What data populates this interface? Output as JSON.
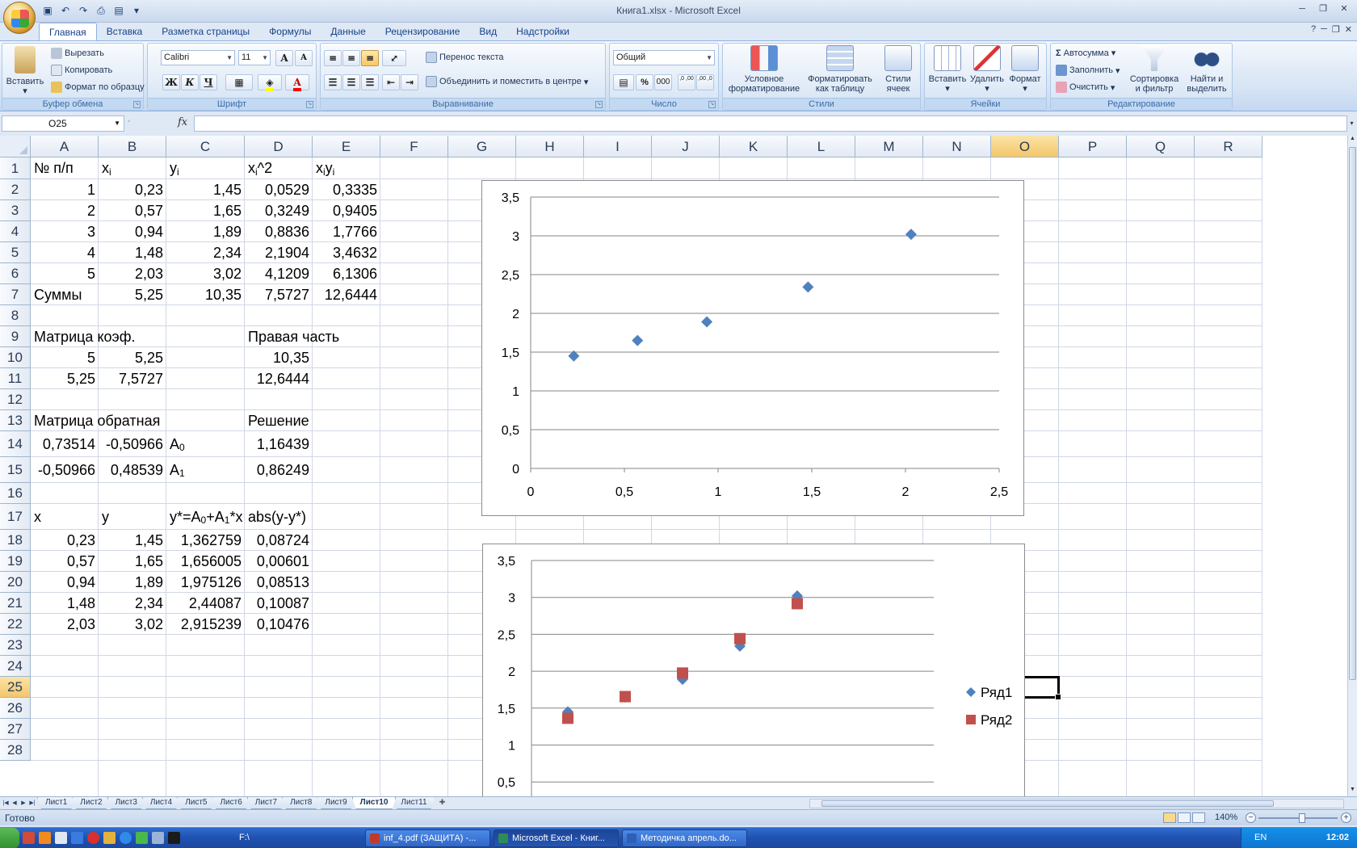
{
  "window": {
    "title": "Книга1.xlsx - Microsoft Excel"
  },
  "qat": {
    "items": [
      "save-icon",
      "undo-icon",
      "redo-icon",
      "print-preview-icon",
      "print-icon",
      "customize-icon"
    ]
  },
  "ribbon_tabs": [
    "Главная",
    "Вставка",
    "Разметка страницы",
    "Формулы",
    "Данные",
    "Рецензирование",
    "Вид",
    "Надстройки"
  ],
  "ribbon": {
    "clipboard": {
      "label": "Буфер обмена",
      "paste": "Вставить",
      "cut": "Вырезать",
      "copy": "Копировать",
      "format_painter": "Формат по образцу"
    },
    "font": {
      "label": "Шрифт",
      "name": "Calibri",
      "size": "11",
      "bold": "Ж",
      "italic": "К",
      "underline": "Ч",
      "grow": "A",
      "shrink": "A"
    },
    "alignment": {
      "label": "Выравнивание",
      "wrap": "Перенос текста",
      "merge": "Объединить и поместить в центре"
    },
    "number": {
      "label": "Число",
      "format": "Общий",
      "percent": "%",
      "thousands": "000",
      "inc_decimal": ",0 ,00",
      "dec_decimal": ",00 ,0"
    },
    "styles": {
      "label": "Стили",
      "conditional": "Условное форматирование",
      "as_table": "Форматировать как таблицу",
      "cell_styles": "Стили ячеек"
    },
    "cells": {
      "label": "Ячейки",
      "insert": "Вставить",
      "delete": "Удалить",
      "format": "Формат"
    },
    "editing": {
      "label": "Редактирование",
      "autosum": "Автосумма",
      "fill": "Заполнить",
      "clear": "Очистить",
      "sort": "Сортировка и фильтр",
      "find": "Найти и выделить"
    }
  },
  "formula_bar": {
    "name_box": "O25",
    "fx": "fx",
    "value": ""
  },
  "columns": [
    "A",
    "B",
    "C",
    "D",
    "E",
    "F",
    "G",
    "H",
    "I",
    "J",
    "K",
    "L",
    "M",
    "N",
    "O",
    "P",
    "Q",
    "R"
  ],
  "rows": [
    "1",
    "2",
    "3",
    "4",
    "5",
    "6",
    "7",
    "8",
    "9",
    "10",
    "11",
    "12",
    "13",
    "14",
    "15",
    "16",
    "17",
    "18",
    "19",
    "20",
    "21",
    "22",
    "23",
    "24",
    "25",
    "26",
    "27",
    "28"
  ],
  "cells": [
    {
      "ref": "A1",
      "text": "№ п/п"
    },
    {
      "ref": "B1",
      "text": "x",
      "sub": "i"
    },
    {
      "ref": "C1",
      "text": "y",
      "sub": "i"
    },
    {
      "ref": "D1",
      "text": "x",
      "sub": "i",
      "tail": "^2"
    },
    {
      "ref": "E1",
      "text": "x",
      "sub": "i",
      "tail": "y",
      "sub2": "i"
    },
    {
      "ref": "A2",
      "text": "1",
      "align": "r"
    },
    {
      "ref": "B2",
      "text": "0,23",
      "align": "r"
    },
    {
      "ref": "C2",
      "text": "1,45",
      "align": "r"
    },
    {
      "ref": "D2",
      "text": "0,0529",
      "align": "r"
    },
    {
      "ref": "E2",
      "text": "0,3335",
      "align": "r"
    },
    {
      "ref": "A3",
      "text": "2",
      "align": "r"
    },
    {
      "ref": "B3",
      "text": "0,57",
      "align": "r"
    },
    {
      "ref": "C3",
      "text": "1,65",
      "align": "r"
    },
    {
      "ref": "D3",
      "text": "0,3249",
      "align": "r"
    },
    {
      "ref": "E3",
      "text": "0,9405",
      "align": "r"
    },
    {
      "ref": "A4",
      "text": "3",
      "align": "r"
    },
    {
      "ref": "B4",
      "text": "0,94",
      "align": "r"
    },
    {
      "ref": "C4",
      "text": "1,89",
      "align": "r"
    },
    {
      "ref": "D4",
      "text": "0,8836",
      "align": "r"
    },
    {
      "ref": "E4",
      "text": "1,7766",
      "align": "r"
    },
    {
      "ref": "A5",
      "text": "4",
      "align": "r"
    },
    {
      "ref": "B5",
      "text": "1,48",
      "align": "r"
    },
    {
      "ref": "C5",
      "text": "2,34",
      "align": "r"
    },
    {
      "ref": "D5",
      "text": "2,1904",
      "align": "r"
    },
    {
      "ref": "E5",
      "text": "3,4632",
      "align": "r"
    },
    {
      "ref": "A6",
      "text": "5",
      "align": "r"
    },
    {
      "ref": "B6",
      "text": "2,03",
      "align": "r"
    },
    {
      "ref": "C6",
      "text": "3,02",
      "align": "r"
    },
    {
      "ref": "D6",
      "text": "4,1209",
      "align": "r"
    },
    {
      "ref": "E6",
      "text": "6,1306",
      "align": "r"
    },
    {
      "ref": "A7",
      "text": "Суммы"
    },
    {
      "ref": "B7",
      "text": "5,25",
      "align": "r"
    },
    {
      "ref": "C7",
      "text": "10,35",
      "align": "r"
    },
    {
      "ref": "D7",
      "text": "7,5727",
      "align": "r"
    },
    {
      "ref": "E7",
      "text": "12,6444",
      "align": "r"
    },
    {
      "ref": "A9",
      "text": "Матрица коэф."
    },
    {
      "ref": "D9",
      "text": "Правая часть"
    },
    {
      "ref": "A10",
      "text": "5",
      "align": "r"
    },
    {
      "ref": "B10",
      "text": "5,25",
      "align": "r"
    },
    {
      "ref": "D10",
      "text": "10,35",
      "align": "r"
    },
    {
      "ref": "A11",
      "text": "5,25",
      "align": "r"
    },
    {
      "ref": "B11",
      "text": "7,5727",
      "align": "r"
    },
    {
      "ref": "D11",
      "text": "12,6444",
      "align": "r"
    },
    {
      "ref": "A13",
      "text": "Матрица обратная"
    },
    {
      "ref": "D13",
      "text": "Решение"
    },
    {
      "ref": "A14",
      "text": "0,73514",
      "align": "r"
    },
    {
      "ref": "B14",
      "text": "-0,50966",
      "align": "r"
    },
    {
      "ref": "C14",
      "text": "A",
      "sub": "0"
    },
    {
      "ref": "D14",
      "text": "1,16439",
      "align": "r"
    },
    {
      "ref": "A15",
      "text": "-0,50966",
      "align": "r"
    },
    {
      "ref": "B15",
      "text": "0,48539",
      "align": "r"
    },
    {
      "ref": "C15",
      "text": "A",
      "sub": "1"
    },
    {
      "ref": "D15",
      "text": "0,86249",
      "align": "r"
    },
    {
      "ref": "A17",
      "text": "x"
    },
    {
      "ref": "B17",
      "text": "y"
    },
    {
      "ref": "C17",
      "text": "y*=A",
      "sub": "0",
      "tail": "+A",
      "sub2": "1",
      "tail2": "*x"
    },
    {
      "ref": "D17",
      "text": "abs(y-y*)"
    },
    {
      "ref": "A18",
      "text": "0,23",
      "align": "r"
    },
    {
      "ref": "B18",
      "text": "1,45",
      "align": "r"
    },
    {
      "ref": "C18",
      "text": "1,362759",
      "align": "r"
    },
    {
      "ref": "D18",
      "text": "0,08724",
      "align": "r"
    },
    {
      "ref": "A19",
      "text": "0,57",
      "align": "r"
    },
    {
      "ref": "B19",
      "text": "1,65",
      "align": "r"
    },
    {
      "ref": "C19",
      "text": "1,656005",
      "align": "r"
    },
    {
      "ref": "D19",
      "text": "0,00601",
      "align": "r"
    },
    {
      "ref": "A20",
      "text": "0,94",
      "align": "r"
    },
    {
      "ref": "B20",
      "text": "1,89",
      "align": "r"
    },
    {
      "ref": "C20",
      "text": "1,975126",
      "align": "r"
    },
    {
      "ref": "D20",
      "text": "0,08513",
      "align": "r"
    },
    {
      "ref": "A21",
      "text": "1,48",
      "align": "r"
    },
    {
      "ref": "B21",
      "text": "2,34",
      "align": "r"
    },
    {
      "ref": "C21",
      "text": "2,44087",
      "align": "r"
    },
    {
      "ref": "D21",
      "text": "0,10087",
      "align": "r"
    },
    {
      "ref": "A22",
      "text": "2,03",
      "align": "r"
    },
    {
      "ref": "B22",
      "text": "3,02",
      "align": "r"
    },
    {
      "ref": "C22",
      "text": "2,915239",
      "align": "r"
    },
    {
      "ref": "D22",
      "text": "0,10476",
      "align": "r"
    }
  ],
  "chart_data": [
    {
      "type": "scatter",
      "title": "",
      "xlabel": "",
      "ylabel": "",
      "xlim": [
        0,
        2.5
      ],
      "ylim": [
        0,
        3.5
      ],
      "xticks": [
        "0",
        "0,5",
        "1",
        "1,5",
        "2",
        "2,5"
      ],
      "yticks": [
        "0",
        "0,5",
        "1",
        "1,5",
        "2",
        "2,5",
        "3",
        "3,5"
      ],
      "grid": "horizontal",
      "series": [
        {
          "x": [
            0.23,
            0.57,
            0.94,
            1.48,
            2.03
          ],
          "values": [
            1.45,
            1.65,
            1.89,
            2.34,
            3.02
          ],
          "color": "#4f81bd",
          "marker": "diamond"
        }
      ]
    },
    {
      "type": "scatter",
      "title": "",
      "xlabel": "",
      "ylabel": "",
      "ylim": [
        0.5,
        3.5
      ],
      "yticks": [
        "0,5",
        "1",
        "1,5",
        "2",
        "2,5",
        "3",
        "3,5"
      ],
      "grid": "horizontal",
      "legend": "right",
      "series": [
        {
          "name": "Ряд1",
          "x": [
            1,
            2,
            3,
            4,
            5
          ],
          "values": [
            1.45,
            1.65,
            1.89,
            2.34,
            3.02
          ],
          "color": "#4f81bd",
          "marker": "diamond"
        },
        {
          "name": "Ряд2",
          "x": [
            1,
            2,
            3,
            4,
            5
          ],
          "values": [
            1.362759,
            1.656005,
            1.975126,
            2.44087,
            2.915239
          ],
          "color": "#c0504d",
          "marker": "square"
        }
      ]
    }
  ],
  "sheet_tabs": [
    "Лист1",
    "Лист2",
    "Лист3",
    "Лист4",
    "Лист5",
    "Лист6",
    "Лист7",
    "Лист8",
    "Лист9",
    "Лист10",
    "Лист11"
  ],
  "active_sheet": "Лист10",
  "status": {
    "ready": "Готово",
    "zoom": "140%"
  },
  "taskbar": {
    "drive": "F:\\",
    "buttons": [
      "inf_4.pdf (ЗАЩИТА) -...",
      "Microsoft Excel - Книг...",
      "Методичка апрель.do..."
    ],
    "lang": "EN",
    "clock": "12:02"
  }
}
